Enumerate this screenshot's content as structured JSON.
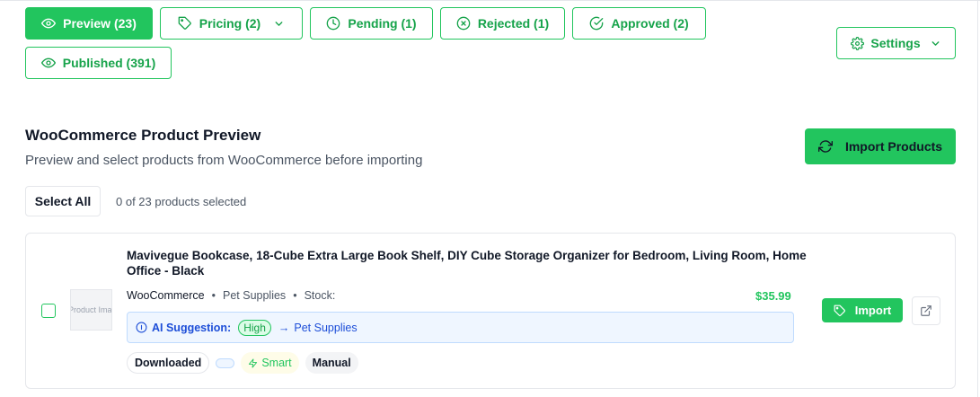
{
  "tabs": [
    {
      "label": "Preview (23)",
      "icon": "eye-icon",
      "active": true
    },
    {
      "label": "Pricing (2)",
      "icon": "tag-icon",
      "dropdown": true
    },
    {
      "label": "Pending (1)",
      "icon": "clock-icon"
    },
    {
      "label": "Rejected (1)",
      "icon": "x-circle-icon"
    },
    {
      "label": "Approved (2)",
      "icon": "check-circle-icon"
    },
    {
      "label": "Published (391)",
      "icon": "eye-icon"
    }
  ],
  "settings": {
    "label": "Settings",
    "icon": "gear-icon"
  },
  "section": {
    "title": "WooCommerce Product Preview",
    "subtitle": "Preview and select products from WooCommerce before importing",
    "import_button": "Import Products"
  },
  "selection": {
    "select_all_label": "Select All",
    "count_text": "0 of 23 products selected"
  },
  "product": {
    "title": "Mavivegue Bookcase, 18-Cube Extra Large Book Shelf, DIY Cube Storage Organizer for Bedroom, Living Room, Home Office - Black",
    "image_alt": "Product Image",
    "source": "WooCommerce",
    "category": "Pet Supplies",
    "stock_label": "Stock:",
    "price": "$35.99",
    "ai": {
      "label": "AI Suggestion:",
      "confidence": "High",
      "arrow": "→",
      "category": "Pet Supplies"
    },
    "tags": {
      "downloaded": "Downloaded",
      "smart": "Smart",
      "manual": "Manual"
    },
    "import_label": "Import",
    "separator": "•"
  },
  "colors": {
    "accent": "#22c55e",
    "accent_dark": "#16a34a",
    "ai_bg": "#eff6ff",
    "ai_text": "#1d4ed8"
  }
}
